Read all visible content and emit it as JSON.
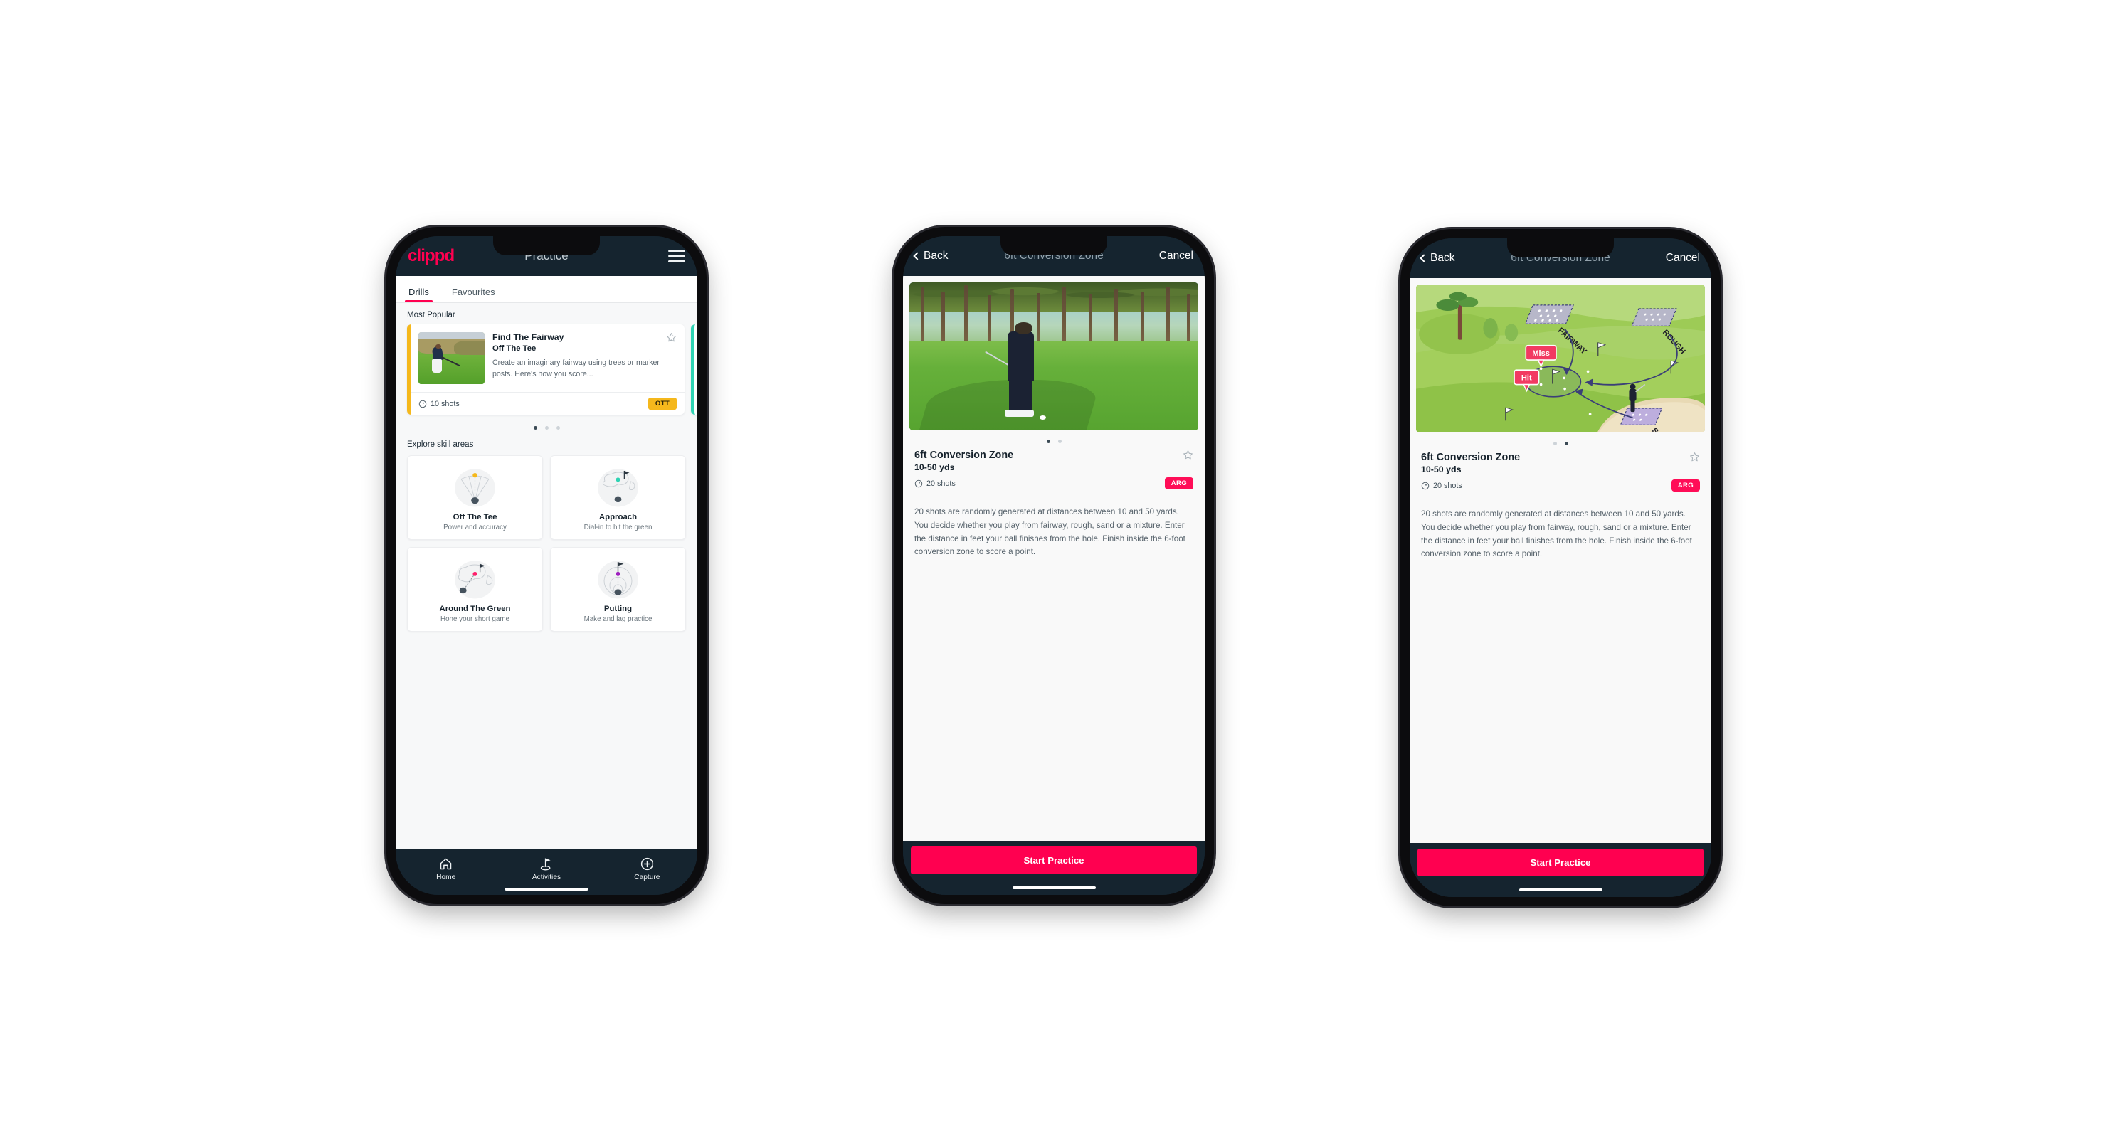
{
  "brand": {
    "logo_text": "clippd",
    "accent_pink": "#FF0050",
    "navy": "#15242F",
    "amber": "#F5B81C",
    "teal": "#2ED3B3"
  },
  "phone1": {
    "appbar": {
      "logo": "clippd",
      "title": "Practice",
      "menu_icon": "hamburger-icon"
    },
    "tabs": [
      {
        "label": "Drills",
        "active": true
      },
      {
        "label": "Favourites",
        "active": false
      }
    ],
    "most_popular": {
      "heading": "Most Popular",
      "card": {
        "name": "Find The Fairway",
        "skill": "Off The Tee",
        "description": "Create an imaginary fairway using trees or marker posts. Here's how you score...",
        "shots": "10 shots",
        "badge": "OTT",
        "favourite_icon": "star-outline-icon",
        "accent": "#F5B81C"
      },
      "pager": {
        "count": 3,
        "active_index": 0
      }
    },
    "skill_areas": {
      "heading": "Explore skill areas",
      "items": [
        {
          "name": "Off The Tee",
          "desc": "Power and accuracy",
          "icon": "tee-fan-icon",
          "accent": "#F5B81C"
        },
        {
          "name": "Approach",
          "desc": "Dial-in to hit the green",
          "icon": "approach-green-icon",
          "accent": "#2ED3B3"
        },
        {
          "name": "Around The Green",
          "desc": "Hone your short game",
          "icon": "around-green-icon",
          "accent": "#FF1F6B"
        },
        {
          "name": "Putting",
          "desc": "Make and lag practice",
          "icon": "putting-rings-icon",
          "accent": "#A020C0"
        }
      ]
    },
    "bottom_nav": [
      {
        "label": "Home",
        "icon": "home-icon",
        "active": false
      },
      {
        "label": "Activities",
        "icon": "golf-flag-icon",
        "active": true
      },
      {
        "label": "Capture",
        "icon": "plus-circle-icon",
        "active": false
      }
    ]
  },
  "phone2": {
    "appbar": {
      "back": "Back",
      "title": "6ft Conversion Zone",
      "cancel": "Cancel",
      "back_icon": "chevron-left-icon"
    },
    "hero": {
      "type": "photo",
      "alt": "golfer-chipping-photo"
    },
    "pager": {
      "count": 2,
      "active_index": 0
    },
    "detail": {
      "title": "6ft Conversion Zone",
      "yards": "10-50 yds",
      "shots": "20 shots",
      "badge": "ARG",
      "favourite_icon": "star-outline-icon",
      "description": "20 shots are randomly generated at distances between 10 and 50 yards. You decide whether you play from fairway, rough, sand or a mixture. Enter the distance in feet your ball finishes from the hole. Finish inside the 6-foot conversion zone to score a point."
    },
    "cta": "Start Practice"
  },
  "phone3": {
    "appbar": {
      "back": "Back",
      "title": "6ft Conversion Zone",
      "cancel": "Cancel",
      "back_icon": "chevron-left-icon"
    },
    "hero": {
      "type": "illustration",
      "alt": "golf-course-diagram",
      "labels": [
        "FAIRWAY",
        "ROUGH",
        "SAND"
      ],
      "markers": [
        "Miss",
        "Hit"
      ]
    },
    "pager": {
      "count": 2,
      "active_index": 1
    },
    "detail": {
      "title": "6ft Conversion Zone",
      "yards": "10-50 yds",
      "shots": "20 shots",
      "badge": "ARG",
      "favourite_icon": "star-outline-icon",
      "description": "20 shots are randomly generated at distances between 10 and 50 yards. You decide whether you play from fairway, rough, sand or a mixture. Enter the distance in feet your ball finishes from the hole. Finish inside the 6-foot conversion zone to score a point."
    },
    "cta": "Start Practice"
  }
}
